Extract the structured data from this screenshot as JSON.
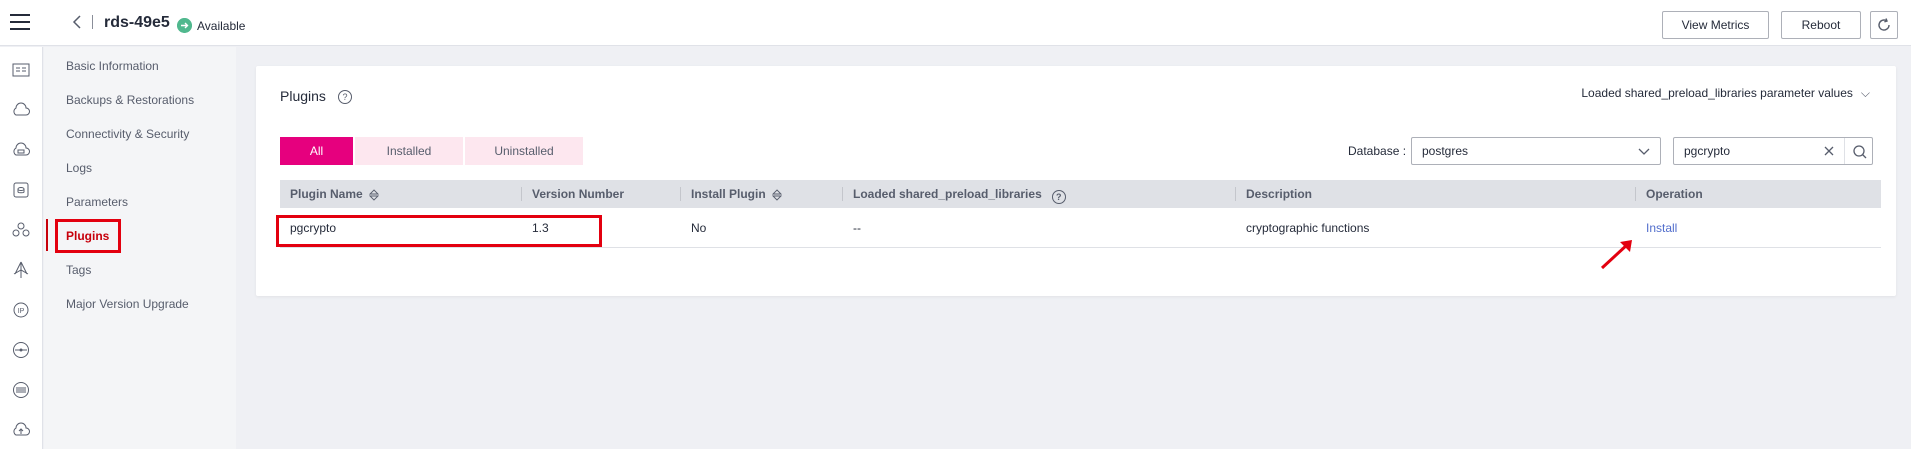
{
  "header": {
    "title": "rds-49e5",
    "status": "Available",
    "buttons": {
      "view_metrics": "View Metrics",
      "reboot": "Reboot"
    }
  },
  "icon_rail": [
    "instance-card-icon",
    "cloud-icon",
    "cloud-db-icon",
    "database-icon",
    "cluster-icon",
    "network-icon",
    "ip-icon",
    "connection-icon",
    "dashboard-icon",
    "cloud-upload-icon"
  ],
  "sidebar": {
    "items": [
      {
        "label": "Basic Information"
      },
      {
        "label": "Backups & Restorations"
      },
      {
        "label": "Connectivity & Security"
      },
      {
        "label": "Logs"
      },
      {
        "label": "Parameters"
      },
      {
        "label": "Plugins",
        "active": true
      },
      {
        "label": "Tags"
      },
      {
        "label": "Major Version Upgrade"
      }
    ]
  },
  "main": {
    "title": "Plugins",
    "help": "?",
    "loaded_link": "Loaded shared_preload_libraries parameter values",
    "tabs": [
      {
        "label": "All",
        "active": true
      },
      {
        "label": "Installed"
      },
      {
        "label": "Uninstalled"
      }
    ],
    "database_label": "Database",
    "database_value": "postgres",
    "search_value": "pgcrypto"
  },
  "table": {
    "columns": [
      "Plugin Name",
      "Version Number",
      "Install Plugin",
      "Loaded shared_preload_libraries",
      "Description",
      "Operation"
    ],
    "rows": [
      {
        "plugin_name": "pgcrypto",
        "version": "1.3",
        "install_plugin": "No",
        "loaded": "--",
        "description": "cryptographic functions",
        "operation": "Install"
      }
    ]
  },
  "colors": {
    "accent": "#e6007e",
    "link": "#526ecc",
    "status_ok": "#50b88e",
    "annotation": "#e3000f"
  }
}
